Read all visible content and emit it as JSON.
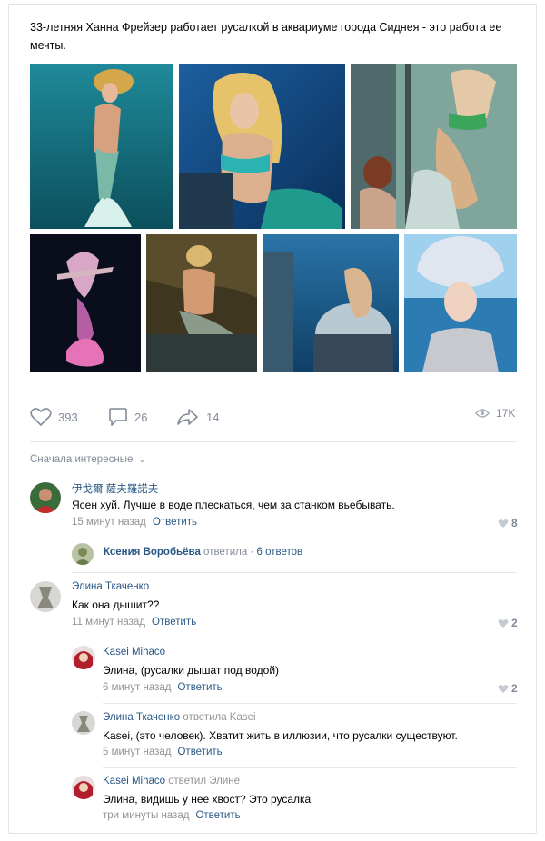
{
  "post": {
    "text": "33-летняя Ханна Фрейзер работает русалкой в аквариуме города Сиднея - это работа ее мечты."
  },
  "actions": {
    "likes": "393",
    "comments": "26",
    "shares": "14",
    "views": "17K"
  },
  "sort_label": "Сначала интересные",
  "comments": [
    {
      "author": "伊戈爾 薩夫羅諾夫",
      "text": "Ясен хуй. Лучше в воде плескаться, чем за станком вьебывать.",
      "time": "15 минут назад",
      "reply": "Ответить",
      "likes": "8"
    },
    {
      "author": "Элина Ткаченко",
      "text": "Как она дышит??",
      "time": "11 минут назад",
      "reply": "Ответить",
      "likes": "2"
    }
  ],
  "thread": {
    "author": "Ксения Воробьёва",
    "verb": "ответила",
    "count": "6 ответов"
  },
  "replies": [
    {
      "author": "Kasei Mihaco",
      "suffix": "",
      "text": "Элина, (русалки дышат под водой)",
      "time": "6 минут назад",
      "reply": "Ответить",
      "likes": "2"
    },
    {
      "author": "Элина Ткаченко",
      "suffix": "ответила Kasei",
      "text": "Kasei, (это человек). Хватит жить в иллюзии, что русалки существуют.",
      "time": "5 минут назад",
      "reply": "Ответить",
      "likes": ""
    },
    {
      "author": "Kasei Mihaco",
      "suffix": "ответил Элине",
      "text": "Элина, видишь у нее хвост? Это русалка",
      "time": "три минуты назад",
      "reply": "Ответить",
      "likes": ""
    }
  ],
  "colors": {
    "link": "#2a5885",
    "muted": "#939393",
    "icon": "#828a99"
  }
}
